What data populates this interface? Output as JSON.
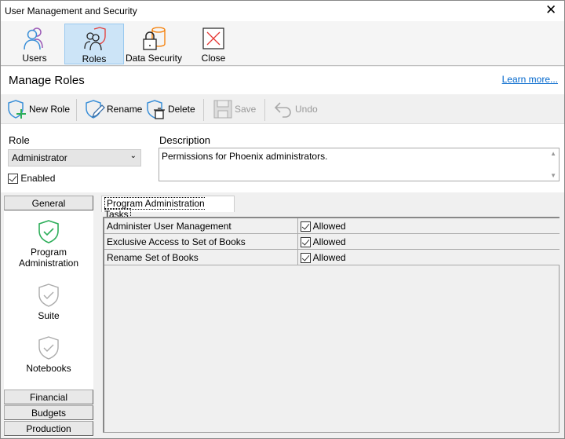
{
  "window": {
    "title": "User Management and Security",
    "close_glyph": "✕"
  },
  "ribbon": [
    {
      "label": "Users",
      "icon": "users-icon"
    },
    {
      "label": "Roles",
      "icon": "roles-icon",
      "selected": true
    },
    {
      "label": "Data Security",
      "icon": "data-security-icon"
    },
    {
      "label": "Close",
      "icon": "close-icon"
    }
  ],
  "header": {
    "title": "Manage Roles",
    "link": "Learn more..."
  },
  "toolbar": {
    "new_role": "New Role",
    "rename": "Rename",
    "delete": "Delete",
    "save": "Save",
    "undo": "Undo"
  },
  "form": {
    "role_label": "Role",
    "role_value": "Administrator",
    "enabled_label": "Enabled",
    "enabled": true,
    "description_label": "Description",
    "description_value": "Permissions for Phoenix administrators."
  },
  "nav": {
    "general": "General",
    "items": [
      {
        "label": "Program Administration",
        "active": true
      },
      {
        "label": "Suite"
      },
      {
        "label": "Notebooks"
      }
    ],
    "financial": "Financial",
    "budgets": "Budgets",
    "production": "Production"
  },
  "tab": "Program Administration Tasks",
  "tasks": [
    {
      "name": "Administer User Management",
      "value": "Allowed",
      "checked": true
    },
    {
      "name": "Exclusive Access to Set of Books",
      "value": "Allowed",
      "checked": true
    },
    {
      "name": "Rename Set of Books",
      "value": "Allowed",
      "checked": true
    }
  ],
  "colors": {
    "accent": "#cce4f7",
    "link": "#0066cc",
    "active_shield": "#2eae5a"
  }
}
